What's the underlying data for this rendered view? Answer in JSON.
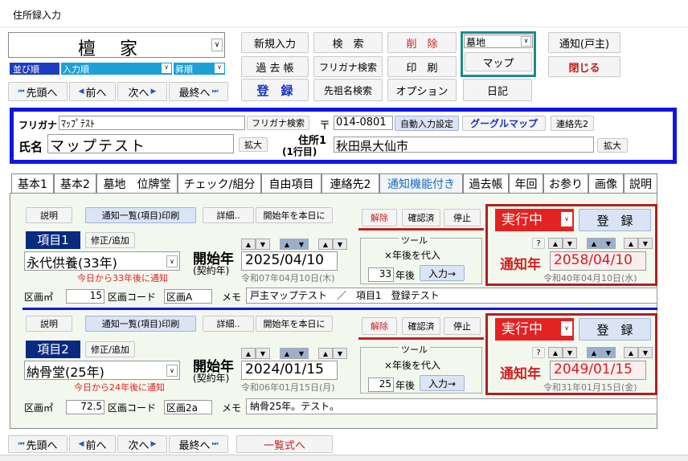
{
  "window_title": "住所録入力",
  "family_name": "檀　家",
  "sort": {
    "label": "並び順",
    "value": "入力順",
    "order": "昇順"
  },
  "nav": {
    "first": "先頭へ",
    "prev": "前へ",
    "next": "次へ",
    "last": "最終へ"
  },
  "toolbar": {
    "new": "新規入力",
    "search": "検　索",
    "delete": "削　除",
    "cemetery_select": "墓地",
    "map": "マップ",
    "notify_head": "通知(戸主)",
    "past": "過 去 帳",
    "furigana_search": "フリガナ検索",
    "print": "印　刷",
    "close": "閉じる",
    "register": "登　録",
    "ancestor_search": "先祖名検索",
    "options": "オプション",
    "diary": "日記"
  },
  "person": {
    "furigana_label": "フリガナ",
    "furigana": "ﾏｯﾌﾟﾃｽﾄ",
    "furigana_search_btn": "フリガナ検索",
    "name_label": "氏名",
    "name": "マップテスト",
    "expand1": "拡大",
    "postal_mark": "〒",
    "postal": "014-0801",
    "auto_input": "自動入力設定",
    "google_map": "グーグルマップ",
    "contact2": "連絡先2",
    "address_label": "住所1",
    "address_sub": "(1行目)",
    "address": "秋田県大仙市",
    "expand2": "拡大"
  },
  "tabs": [
    "基本1",
    "基本2",
    "墓地　位牌堂",
    "チェック/組分",
    "自由項目",
    "連絡先2",
    "通知機能付き",
    "過去帳",
    "年回",
    "お参り",
    "画像",
    "説明"
  ],
  "items": [
    {
      "explain": "説明",
      "list_print": "通知一覧(項目)印刷",
      "detail": "詳細..",
      "start_today": "開始年を本日に",
      "cancel": "解除",
      "confirmed": "確認済",
      "stop": "停止",
      "running": "実行中",
      "register": "登　録",
      "item_label": "項目1",
      "edit_add": "修正/追加",
      "service": "永代供養(33年)",
      "note": "今日から33年後に通知",
      "start_label": "開始年",
      "start_sub": "(契約年)",
      "start_date": "2025/04/10",
      "start_wareki": "令和07年04月10日(木)",
      "tool_label": "ツール",
      "years_after_label": "×年後を代入",
      "years": "33",
      "years_unit": "年後",
      "input_btn": "入力→",
      "question": "?",
      "notify_label": "通知年",
      "notify_date": "2058/04/10",
      "notify_wareki": "令和40年04月10日(水)",
      "plot_label": "区画㎡",
      "plot_value": "15",
      "code_label": "区画コード",
      "code": "区画A",
      "memo_label": "メモ",
      "memo": "戸主マップテスト　／　項目1　登録テスト"
    },
    {
      "explain": "説明",
      "list_print": "通知一覧(項目)印刷",
      "detail": "詳細..",
      "start_today": "開始年を本日に",
      "cancel": "解除",
      "confirmed": "確認済",
      "stop": "停止",
      "running": "実行中",
      "register": "登　録",
      "item_label": "項目2",
      "edit_add": "修正/追加",
      "service": "納骨堂(25年)",
      "note": "今日から24年後に通知",
      "start_label": "開始年",
      "start_sub": "(契約年)",
      "start_date": "2024/01/15",
      "start_wareki": "令和06年01月15日(月)",
      "tool_label": "ツール",
      "years_after_label": "×年後を代入",
      "years": "25",
      "years_unit": "年後",
      "input_btn": "入力→",
      "question": "?",
      "notify_label": "通知年",
      "notify_date": "2049/01/15",
      "notify_wareki": "令和31年01月15日(金)",
      "plot_label": "区画㎡",
      "plot_value": "72.5",
      "code_label": "区画コード",
      "code": "区画2a",
      "memo_label": "メモ",
      "memo": "納骨25年。テスト。"
    }
  ],
  "bottom": {
    "list_form": "一覧式へ"
  },
  "colors": {
    "blue": "#1016e0",
    "red": "#e32222",
    "teal": "#1f8a8a",
    "navy": "#0a2a80"
  }
}
